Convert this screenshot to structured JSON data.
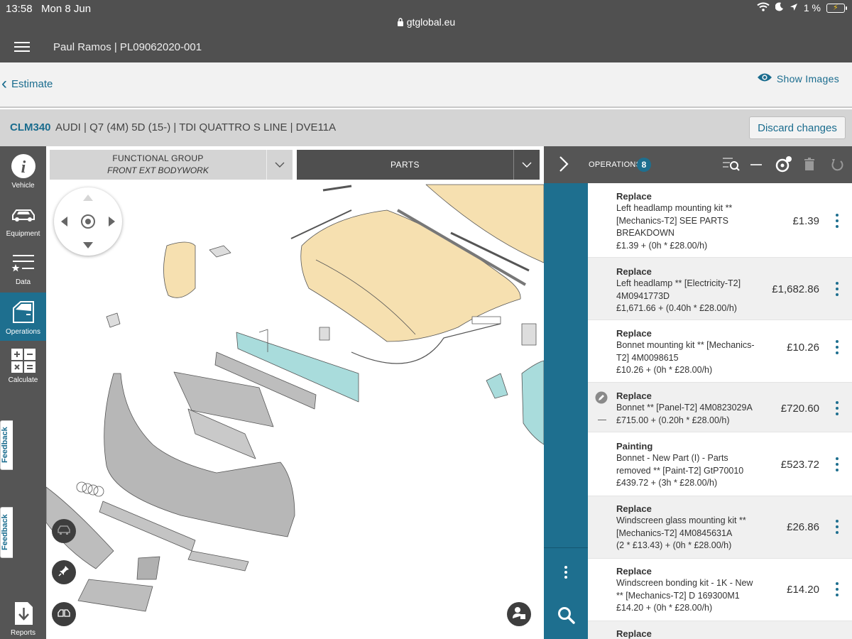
{
  "status": {
    "time": "13:58",
    "date": "Mon 8 Jun",
    "url": "gtglobal.eu",
    "battery": "1 %"
  },
  "header": {
    "title": "Paul Ramos | PL09062020-001"
  },
  "breadcrumb": {
    "back_label": "Estimate",
    "show_images": "Show Images"
  },
  "vehicle": {
    "code": "CLM340",
    "description": "AUDI | Q7 (4M) 5D (15-) | TDI QUATTRO S LINE | DVE11A",
    "discard_label": "Discard changes"
  },
  "sidebar": {
    "items": [
      {
        "label": "Vehicle",
        "icon": "info-icon"
      },
      {
        "label": "Equipment",
        "icon": "car-icon"
      },
      {
        "label": "Data",
        "icon": "list-star-icon"
      },
      {
        "label": "Operations",
        "icon": "door-icon"
      },
      {
        "label": "Calculate",
        "icon": "calculator-icon"
      },
      {
        "label": "Reports",
        "icon": "download-report-icon"
      }
    ],
    "feedback_label": "Feedback"
  },
  "diagram": {
    "functional_group_label": "FUNCTIONAL GROUP",
    "functional_group_value": "FRONT EXT BODYWORK",
    "parts_label": "PARTS"
  },
  "operations": {
    "label": "OPERATIONS",
    "count": "8",
    "items": [
      {
        "type": "Replace",
        "desc": "Left headlamp mounting kit ** [Mechanics-T2] SEE PARTS BREAKDOWN",
        "formula": "£1.39 + (0h * £28.00/h)",
        "price": "£1.39"
      },
      {
        "type": "Replace",
        "desc": "Left headlamp ** [Electricity-T2] 4M0941773D",
        "formula": "£1,671.66 + (0.40h * £28.00/h)",
        "price": "£1,682.86"
      },
      {
        "type": "Replace",
        "desc": "Bonnet mounting kit ** [Mechanics-T2] 4M0098615",
        "formula": "£10.26 + (0h * £28.00/h)",
        "price": "£10.26"
      },
      {
        "type": "Replace",
        "desc": "Bonnet ** [Panel-T2] 4M0823029A",
        "formula": "£715.00 + (0.20h * £28.00/h)",
        "price": "£720.60"
      },
      {
        "type": "Painting",
        "desc": "Bonnet - New Part (I) - Parts removed ** [Paint-T2] GtP70010",
        "formula": "£439.72 + (3h * £28.00/h)",
        "price": "£523.72"
      },
      {
        "type": "Replace",
        "desc": "Windscreen glass mounting kit ** [Mechanics-T2] 4M0845631A",
        "formula": "(2 * £13.43) + (0h * £28.00/h)",
        "price": "£26.86"
      },
      {
        "type": "Replace",
        "desc": "Windscreen bonding kit - 1K - New ** [Mechanics-T2] D 169300M1",
        "formula": "£14.20 + (0h * £28.00/h)",
        "price": "£14.20"
      },
      {
        "type": "Replace",
        "desc": "",
        "formula": "",
        "price": ""
      }
    ]
  },
  "colors": {
    "accent": "#1e6f8f",
    "dark": "#505050",
    "bonnet": "#f6e0b0",
    "highlight": "#a9dcdc",
    "parts_grey": "#b7b7b7"
  }
}
